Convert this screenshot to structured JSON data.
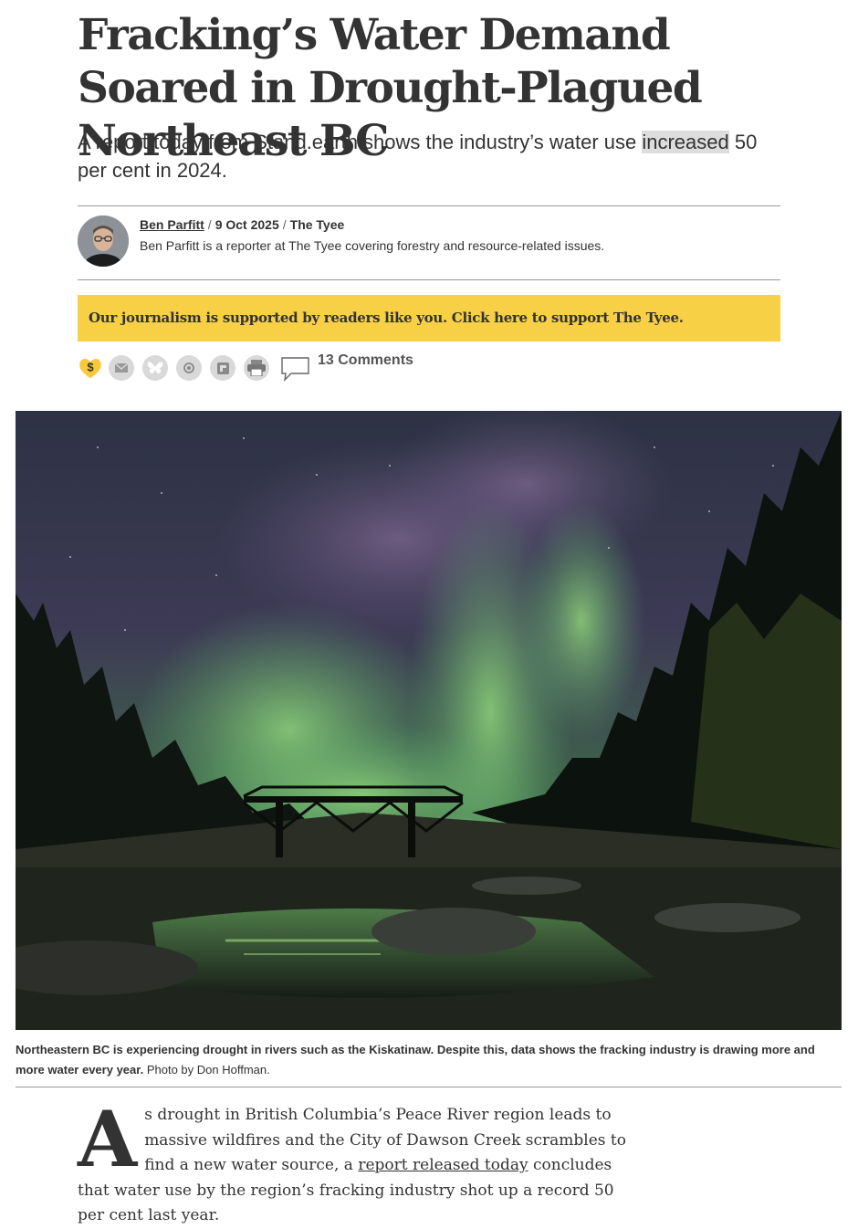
{
  "article": {
    "headline": "Fracking’s Water Demand Soared in Drought-Plagued Northeast BC",
    "dek_before": "A report today from Stand.earth shows the industry’s water use ",
    "dek_highlight": "increased",
    "dek_after": " 50 per cent in 2024."
  },
  "byline": {
    "author": "Ben Parfitt",
    "date": "9 Oct 2025",
    "publication": "The Tyee",
    "bio": "Ben Parfitt is a reporter at The Tyee covering forestry and resource-related issues."
  },
  "support_banner": {
    "text": "Our journalism is supported by readers like you. Click here to support The Tyee.",
    "color": "#f8d046"
  },
  "share": {
    "icons": [
      "donate-heart-icon",
      "email-icon",
      "bluesky-icon",
      "mastodon-icon",
      "flipboard-icon",
      "print-icon",
      "comment-icon"
    ],
    "comments_label": "13 Comments"
  },
  "photo": {
    "caption_bold": "Northeastern BC is experiencing drought in rivers such as the Kiskatinaw. Despite this, data shows the fracking industry is drawing more and more water every year.",
    "credit": " Photo by Don Hoffman."
  },
  "body": {
    "dropcap": "A",
    "p1_before": "s drought in British Columbia’s Peace River region leads to massive wildfires and the City of Dawson Creek scrambles to find a new water source, a ",
    "p1_link": "report released today",
    "p1_after": " concludes that water use by the region’s fracking industry shot up a record 50 per cent last year."
  }
}
